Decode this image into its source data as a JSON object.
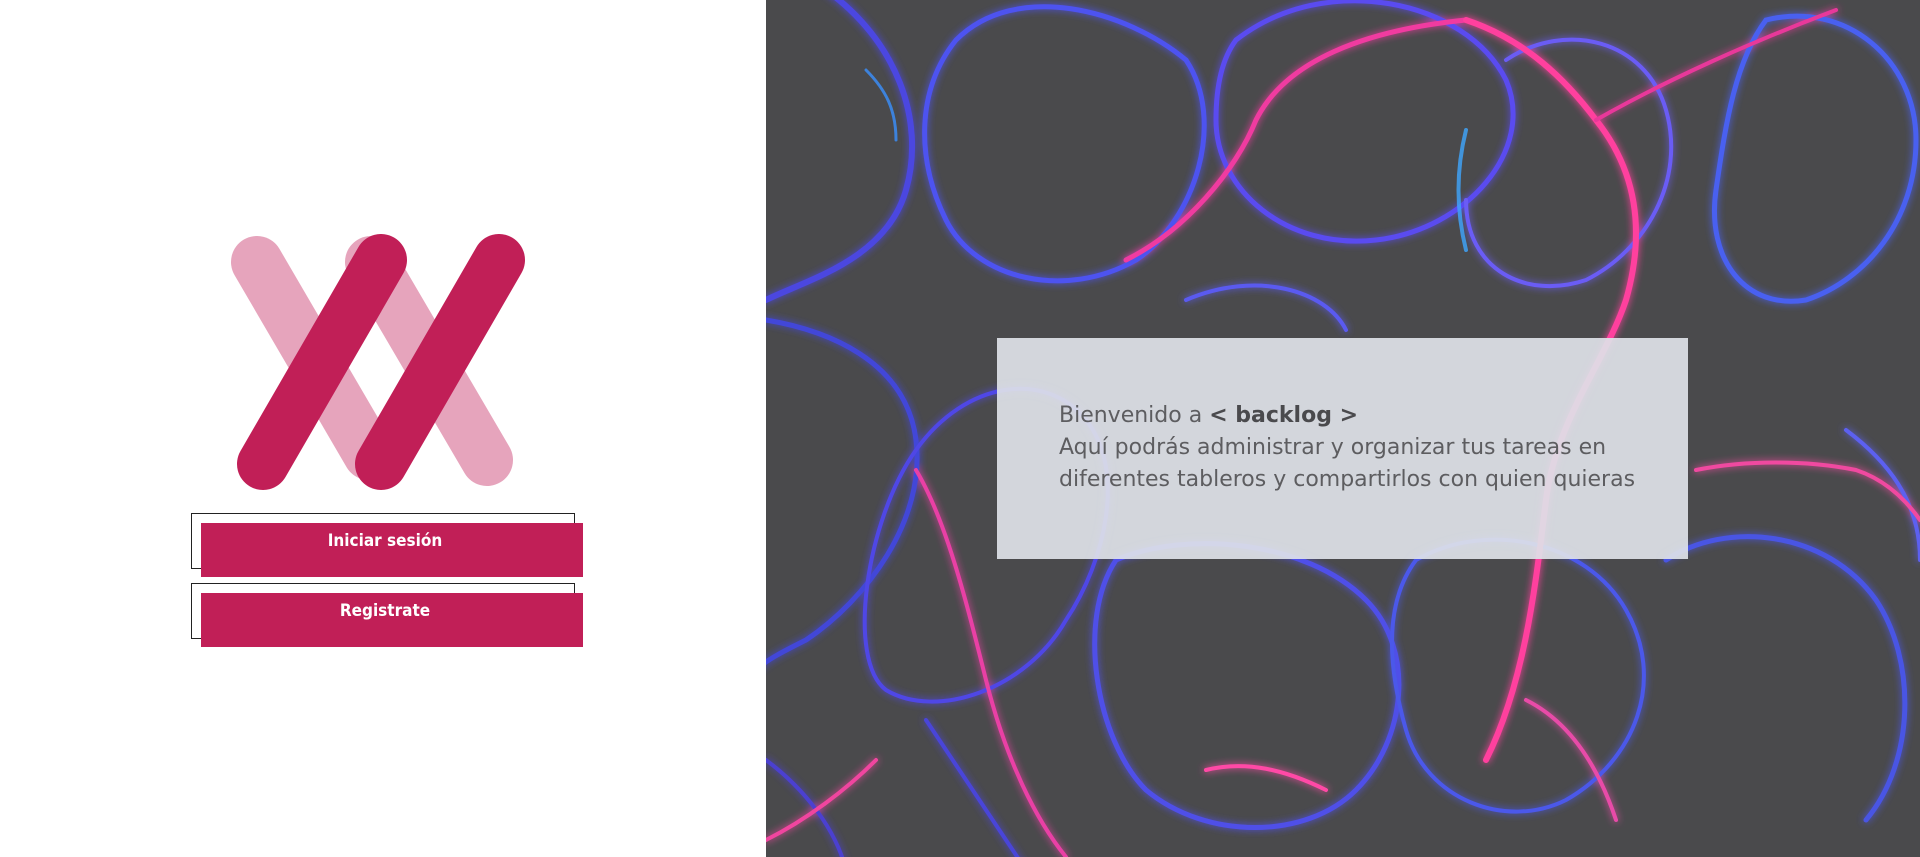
{
  "login": {
    "logo_icon": "backlog-x-logo",
    "login_button_label": "Iniciar sesión",
    "register_button_label": "Registrate"
  },
  "welcome": {
    "prefix": "Bienvenido a",
    "brand": "< backlog >",
    "line2": "Aquí podrás administrar y organizar tus tareas en",
    "line3": "diferentes tableros y compartirlos con quien quieras"
  },
  "colors": {
    "accent": "#c11f57",
    "accent_light": "#e6a4bc",
    "background_dark": "#4a4a4c",
    "card": "#dee2e8"
  }
}
